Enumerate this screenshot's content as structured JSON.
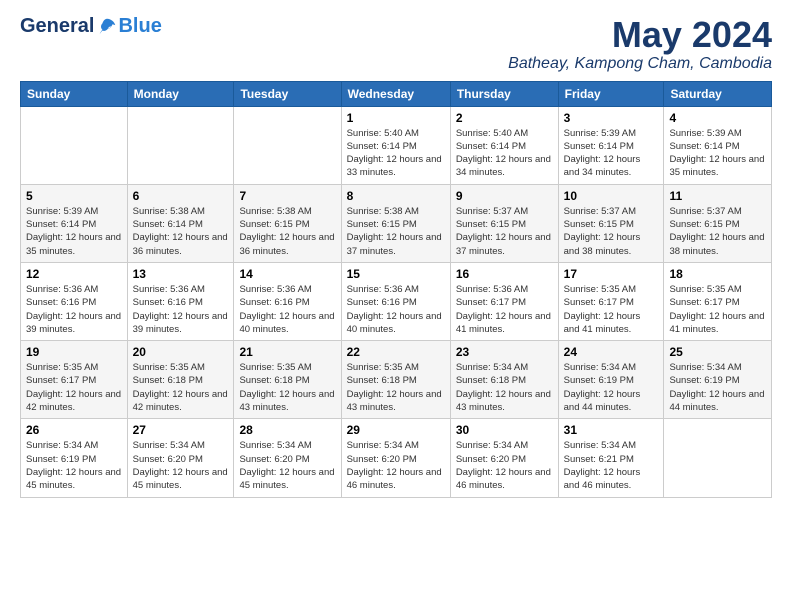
{
  "logo": {
    "general": "General",
    "blue": "Blue"
  },
  "title": "May 2024",
  "location": "Batheay, Kampong Cham, Cambodia",
  "days_header": [
    "Sunday",
    "Monday",
    "Tuesday",
    "Wednesday",
    "Thursday",
    "Friday",
    "Saturday"
  ],
  "weeks": [
    [
      {
        "day": "",
        "sunrise": "",
        "sunset": "",
        "daylight": ""
      },
      {
        "day": "",
        "sunrise": "",
        "sunset": "",
        "daylight": ""
      },
      {
        "day": "",
        "sunrise": "",
        "sunset": "",
        "daylight": ""
      },
      {
        "day": "1",
        "sunrise": "Sunrise: 5:40 AM",
        "sunset": "Sunset: 6:14 PM",
        "daylight": "Daylight: 12 hours and 33 minutes."
      },
      {
        "day": "2",
        "sunrise": "Sunrise: 5:40 AM",
        "sunset": "Sunset: 6:14 PM",
        "daylight": "Daylight: 12 hours and 34 minutes."
      },
      {
        "day": "3",
        "sunrise": "Sunrise: 5:39 AM",
        "sunset": "Sunset: 6:14 PM",
        "daylight": "Daylight: 12 hours and 34 minutes."
      },
      {
        "day": "4",
        "sunrise": "Sunrise: 5:39 AM",
        "sunset": "Sunset: 6:14 PM",
        "daylight": "Daylight: 12 hours and 35 minutes."
      }
    ],
    [
      {
        "day": "5",
        "sunrise": "Sunrise: 5:39 AM",
        "sunset": "Sunset: 6:14 PM",
        "daylight": "Daylight: 12 hours and 35 minutes."
      },
      {
        "day": "6",
        "sunrise": "Sunrise: 5:38 AM",
        "sunset": "Sunset: 6:14 PM",
        "daylight": "Daylight: 12 hours and 36 minutes."
      },
      {
        "day": "7",
        "sunrise": "Sunrise: 5:38 AM",
        "sunset": "Sunset: 6:15 PM",
        "daylight": "Daylight: 12 hours and 36 minutes."
      },
      {
        "day": "8",
        "sunrise": "Sunrise: 5:38 AM",
        "sunset": "Sunset: 6:15 PM",
        "daylight": "Daylight: 12 hours and 37 minutes."
      },
      {
        "day": "9",
        "sunrise": "Sunrise: 5:37 AM",
        "sunset": "Sunset: 6:15 PM",
        "daylight": "Daylight: 12 hours and 37 minutes."
      },
      {
        "day": "10",
        "sunrise": "Sunrise: 5:37 AM",
        "sunset": "Sunset: 6:15 PM",
        "daylight": "Daylight: 12 hours and 38 minutes."
      },
      {
        "day": "11",
        "sunrise": "Sunrise: 5:37 AM",
        "sunset": "Sunset: 6:15 PM",
        "daylight": "Daylight: 12 hours and 38 minutes."
      }
    ],
    [
      {
        "day": "12",
        "sunrise": "Sunrise: 5:36 AM",
        "sunset": "Sunset: 6:16 PM",
        "daylight": "Daylight: 12 hours and 39 minutes."
      },
      {
        "day": "13",
        "sunrise": "Sunrise: 5:36 AM",
        "sunset": "Sunset: 6:16 PM",
        "daylight": "Daylight: 12 hours and 39 minutes."
      },
      {
        "day": "14",
        "sunrise": "Sunrise: 5:36 AM",
        "sunset": "Sunset: 6:16 PM",
        "daylight": "Daylight: 12 hours and 40 minutes."
      },
      {
        "day": "15",
        "sunrise": "Sunrise: 5:36 AM",
        "sunset": "Sunset: 6:16 PM",
        "daylight": "Daylight: 12 hours and 40 minutes."
      },
      {
        "day": "16",
        "sunrise": "Sunrise: 5:36 AM",
        "sunset": "Sunset: 6:17 PM",
        "daylight": "Daylight: 12 hours and 41 minutes."
      },
      {
        "day": "17",
        "sunrise": "Sunrise: 5:35 AM",
        "sunset": "Sunset: 6:17 PM",
        "daylight": "Daylight: 12 hours and 41 minutes."
      },
      {
        "day": "18",
        "sunrise": "Sunrise: 5:35 AM",
        "sunset": "Sunset: 6:17 PM",
        "daylight": "Daylight: 12 hours and 41 minutes."
      }
    ],
    [
      {
        "day": "19",
        "sunrise": "Sunrise: 5:35 AM",
        "sunset": "Sunset: 6:17 PM",
        "daylight": "Daylight: 12 hours and 42 minutes."
      },
      {
        "day": "20",
        "sunrise": "Sunrise: 5:35 AM",
        "sunset": "Sunset: 6:18 PM",
        "daylight": "Daylight: 12 hours and 42 minutes."
      },
      {
        "day": "21",
        "sunrise": "Sunrise: 5:35 AM",
        "sunset": "Sunset: 6:18 PM",
        "daylight": "Daylight: 12 hours and 43 minutes."
      },
      {
        "day": "22",
        "sunrise": "Sunrise: 5:35 AM",
        "sunset": "Sunset: 6:18 PM",
        "daylight": "Daylight: 12 hours and 43 minutes."
      },
      {
        "day": "23",
        "sunrise": "Sunrise: 5:34 AM",
        "sunset": "Sunset: 6:18 PM",
        "daylight": "Daylight: 12 hours and 43 minutes."
      },
      {
        "day": "24",
        "sunrise": "Sunrise: 5:34 AM",
        "sunset": "Sunset: 6:19 PM",
        "daylight": "Daylight: 12 hours and 44 minutes."
      },
      {
        "day": "25",
        "sunrise": "Sunrise: 5:34 AM",
        "sunset": "Sunset: 6:19 PM",
        "daylight": "Daylight: 12 hours and 44 minutes."
      }
    ],
    [
      {
        "day": "26",
        "sunrise": "Sunrise: 5:34 AM",
        "sunset": "Sunset: 6:19 PM",
        "daylight": "Daylight: 12 hours and 45 minutes."
      },
      {
        "day": "27",
        "sunrise": "Sunrise: 5:34 AM",
        "sunset": "Sunset: 6:20 PM",
        "daylight": "Daylight: 12 hours and 45 minutes."
      },
      {
        "day": "28",
        "sunrise": "Sunrise: 5:34 AM",
        "sunset": "Sunset: 6:20 PM",
        "daylight": "Daylight: 12 hours and 45 minutes."
      },
      {
        "day": "29",
        "sunrise": "Sunrise: 5:34 AM",
        "sunset": "Sunset: 6:20 PM",
        "daylight": "Daylight: 12 hours and 46 minutes."
      },
      {
        "day": "30",
        "sunrise": "Sunrise: 5:34 AM",
        "sunset": "Sunset: 6:20 PM",
        "daylight": "Daylight: 12 hours and 46 minutes."
      },
      {
        "day": "31",
        "sunrise": "Sunrise: 5:34 AM",
        "sunset": "Sunset: 6:21 PM",
        "daylight": "Daylight: 12 hours and 46 minutes."
      },
      {
        "day": "",
        "sunrise": "",
        "sunset": "",
        "daylight": ""
      }
    ]
  ]
}
